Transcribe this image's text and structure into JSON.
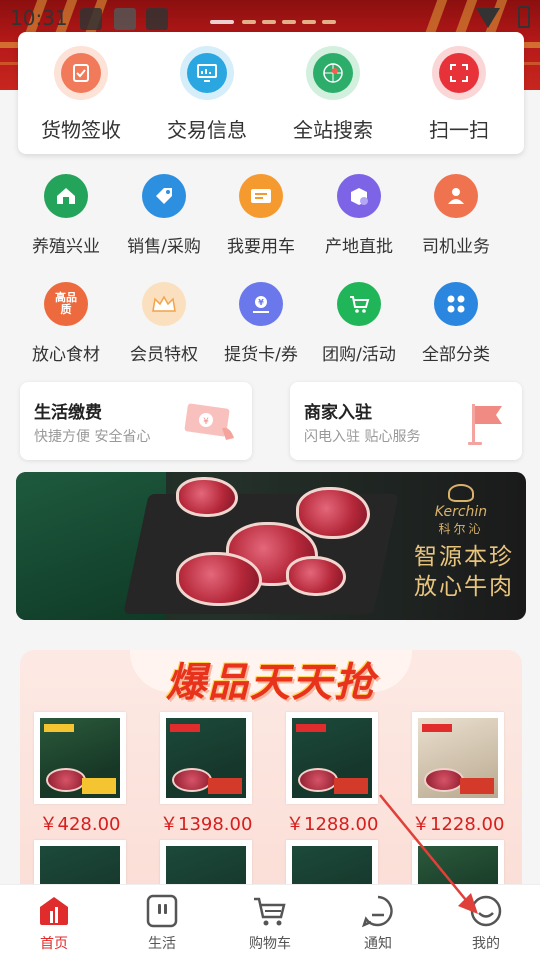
{
  "status_bar": {
    "time": "10:31"
  },
  "quick_actions": [
    {
      "label": "货物签收",
      "icon": "clipboard-check-icon",
      "color": "#f07a5a"
    },
    {
      "label": "交易信息",
      "icon": "monitor-chart-icon",
      "color": "#2aa6e0"
    },
    {
      "label": "全站搜索",
      "icon": "radar-search-icon",
      "color": "#2cae6a"
    },
    {
      "label": "扫一扫",
      "icon": "scan-frame-icon",
      "color": "#e8323a"
    }
  ],
  "grid": [
    {
      "label": "养殖兴业",
      "icon": "farm-house-icon",
      "color": "#23a45a"
    },
    {
      "label": "销售/采购",
      "icon": "price-tag-icon",
      "color": "#2d8fe0"
    },
    {
      "label": "我要用车",
      "icon": "truck-card-icon",
      "color": "#f59a2f"
    },
    {
      "label": "产地直批",
      "icon": "box-check-icon",
      "color": "#7d63e6"
    },
    {
      "label": "司机业务",
      "icon": "driver-icon",
      "color": "#f0734f"
    },
    {
      "label": "放心食材",
      "icon": "quality-badge-icon",
      "color": "#ec6a3e",
      "glyph": "高品质"
    },
    {
      "label": "会员特权",
      "icon": "crown-icon",
      "color": "#f3a34a"
    },
    {
      "label": "提货卡/券",
      "icon": "coupon-hand-icon",
      "color": "#6a78ec"
    },
    {
      "label": "团购/活动",
      "icon": "cart-icon",
      "color": "#21b55a"
    },
    {
      "label": "全部分类",
      "icon": "grid-apps-icon",
      "color": "#2b86e0"
    }
  ],
  "services": [
    {
      "title": "生活缴费",
      "subtitle": "快捷方便 安全省心",
      "icon": "payment-card-icon"
    },
    {
      "title": "商家入驻",
      "subtitle": "闪电入驻 贴心服务",
      "icon": "flag-icon"
    }
  ],
  "banner": {
    "brand": "Kerchin",
    "brand_cn": "科尔沁",
    "slogan_line1": "智源本珍",
    "slogan_line2": "放心牛肉"
  },
  "deals": {
    "title": "爆品天天抢",
    "products": [
      {
        "price": "￥428.00"
      },
      {
        "price": "￥1398.00"
      },
      {
        "price": "￥1288.00"
      },
      {
        "price": "￥1228.00"
      }
    ]
  },
  "bottom_nav": [
    {
      "label": "首页",
      "icon": "home-icon",
      "active": true
    },
    {
      "label": "生活",
      "icon": "life-icon",
      "active": false
    },
    {
      "label": "购物车",
      "icon": "shopping-cart-icon",
      "active": false
    },
    {
      "label": "通知",
      "icon": "notification-icon",
      "active": false
    },
    {
      "label": "我的",
      "icon": "profile-icon",
      "active": false
    }
  ],
  "colors": {
    "accent": "#e02c2c",
    "price": "#d81e1e"
  }
}
